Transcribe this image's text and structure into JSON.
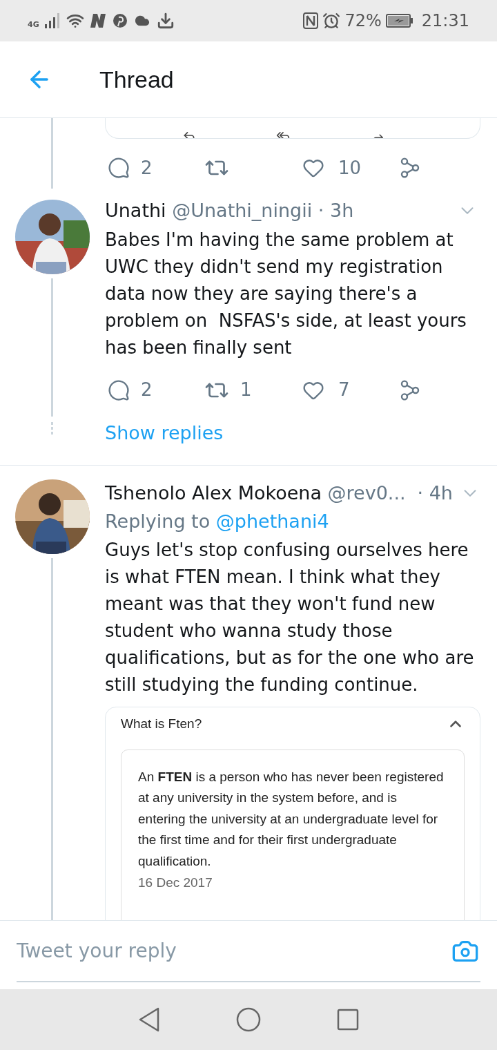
{
  "status_bar": {
    "network": "4G",
    "battery": "72%",
    "time": "21:31"
  },
  "header": {
    "title": "Thread"
  },
  "top_tweet": {
    "actions": {
      "replies": "2",
      "likes": "10"
    }
  },
  "tweets": [
    {
      "name": "Unathi",
      "handle": "@Unathi_ningii · 3h",
      "text": "Babes I'm having the same problem at UWC they didn't send my registration data now they are saying there's a problem on  NSFAS's side, at least yours has been finally sent",
      "actions": {
        "replies": "2",
        "retweets": "1",
        "likes": "7"
      },
      "show_replies": "Show replies"
    },
    {
      "name": "Tshenolo Alex Mokoena",
      "handle": "@rev0...",
      "time": "· 4h",
      "replying_label": "Replying to",
      "replying_to": "@phethani4",
      "text": "Guys let's stop confusing ourselves here is what FTEN mean. I think what they meant was that they won't fund new student who wanna study those qualifications, but as for the one who are still studying the funding continue.",
      "embed": {
        "question": "What is Ften?",
        "expanded": true,
        "answer": "An **FTEN** is a person who has never been registered at any university in the system before, and is entering the university at an undergraduate level for the first time and for their first undergraduate qualification.",
        "date": "16 Dec 2017"
      }
    }
  ],
  "reply_bar": {
    "placeholder": "Tweet your reply"
  }
}
